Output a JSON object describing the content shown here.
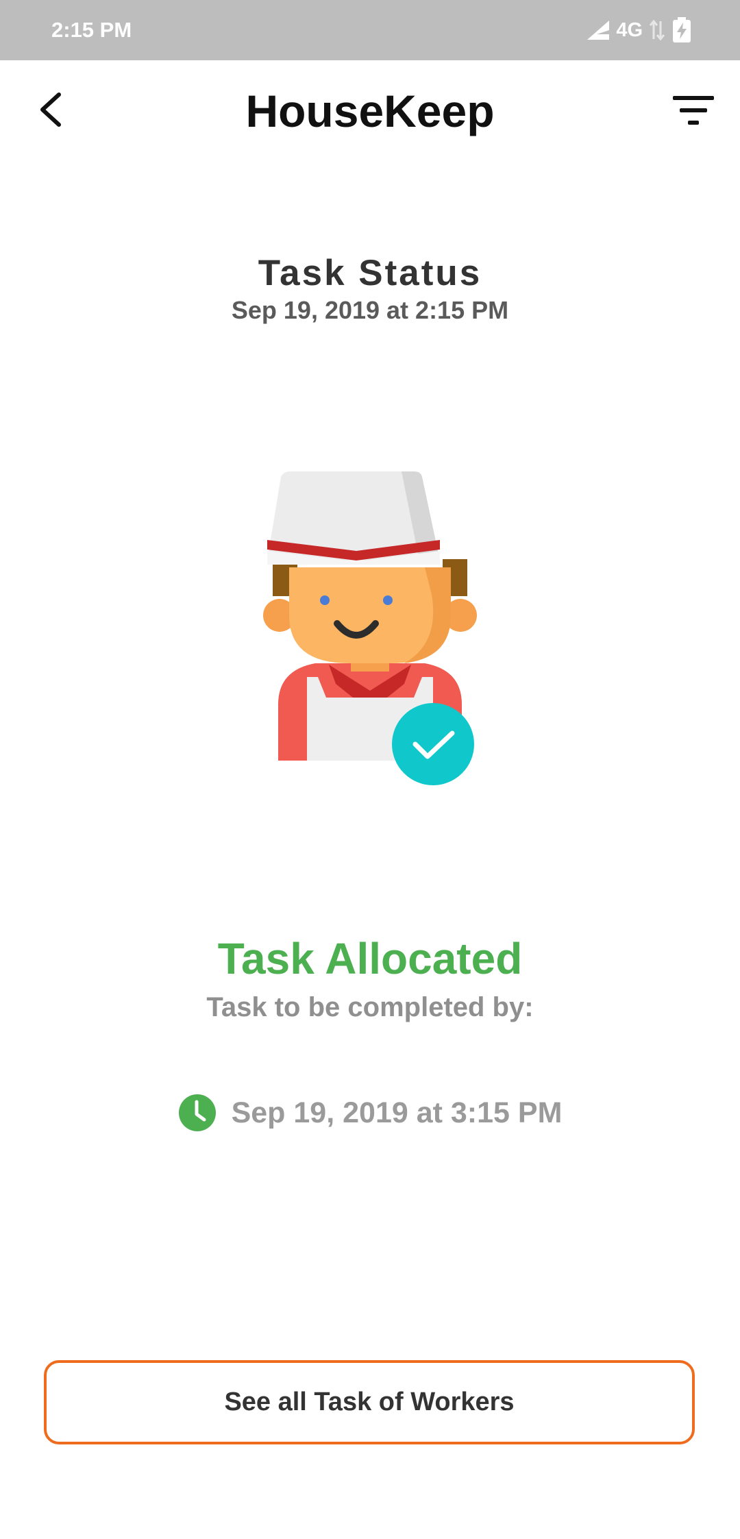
{
  "status_bar": {
    "time": "2:15 PM",
    "network": "4G",
    "icons": [
      "signal-icon",
      "data-arrows-icon",
      "battery-charging-icon"
    ]
  },
  "app_bar": {
    "title": "HouseKeep",
    "back_icon": "back-arrow-icon",
    "filter_icon": "filter-icon"
  },
  "task": {
    "heading": "Task Status",
    "created_at": "Sep 19, 2019 at 2:15 PM",
    "status": "Task Allocated",
    "status_color": "#4caf50",
    "completed_by_label": "Task to be completed by:",
    "due_at": "Sep 19, 2019 at 3:15 PM",
    "illustration": "worker-avatar-checkmark"
  },
  "actions": {
    "workers_button_label": "See all Task of Workers",
    "accent_color": "#ef6c1e"
  }
}
